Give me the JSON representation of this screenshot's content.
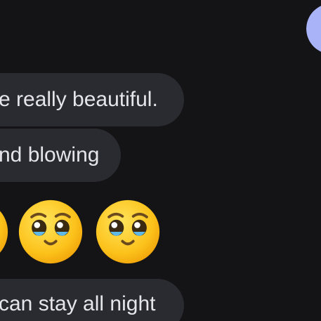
{
  "colors": {
    "background": "#141416",
    "bubble": "#2a2b30",
    "bubble_text": "#e6e6ea",
    "avatar": "#a9b4f8",
    "emoji_face": "#fcc21b",
    "emoji_feature": "#6b4a1e",
    "emoji_tear": "#5fb8e6"
  },
  "messages": [
    {
      "text": "e really beautiful."
    },
    {
      "text": "nd blowing"
    },
    {
      "emoji": [
        "holding-back-tears",
        "holding-back-tears",
        "holding-back-tears"
      ]
    },
    {
      "text": "can stay all night"
    }
  ],
  "icons": {
    "avatar": "contact-avatar-icon",
    "emoji": "face-holding-back-tears-icon"
  }
}
